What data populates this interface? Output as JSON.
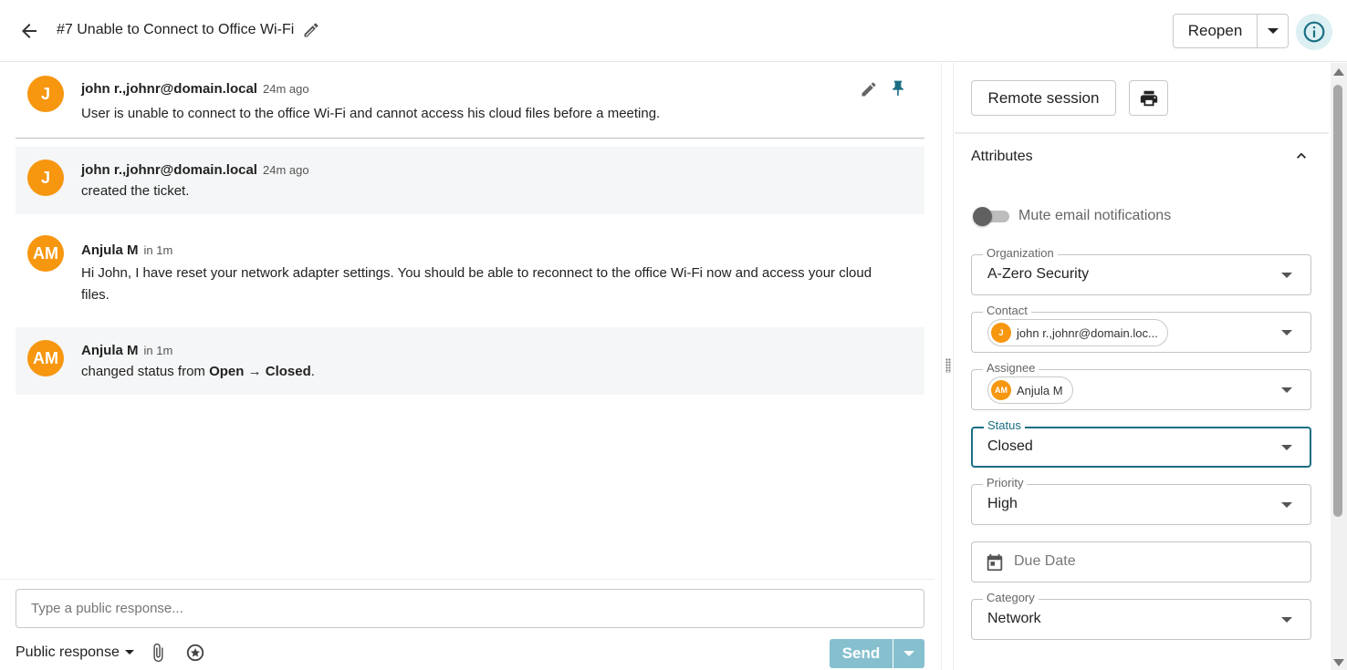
{
  "header": {
    "ticket_title": "#7 Unable to Connect to Office Wi-Fi",
    "reopen_label": "Reopen"
  },
  "messages": [
    {
      "avatar": "J",
      "author": "john r.,johnr@domain.local",
      "time": "24m ago",
      "text": "User is unable to connect to the office Wi-Fi and cannot access his cloud files before a meeting."
    },
    {
      "avatar": "J",
      "author": "john r.,johnr@domain.local",
      "time": "24m ago",
      "text": "created the ticket."
    },
    {
      "avatar": "AM",
      "author": "Anjula M",
      "time": "in 1m",
      "text": "Hi John, I have reset your network adapter settings. You should be able to reconnect to the office Wi-Fi now and access your cloud files."
    },
    {
      "avatar": "AM",
      "author": "Anjula M",
      "time": "in 1m",
      "text_prefix": "changed status from ",
      "status_from": "Open",
      "arrow": " → ",
      "status_to": "Closed",
      "text_suffix": "."
    }
  ],
  "composer": {
    "placeholder": "Type a public response...",
    "response_type": "Public response",
    "send_label": "Send"
  },
  "sidebar": {
    "remote_session_label": "Remote session",
    "attributes_heading": "Attributes",
    "mute_label": "Mute email notifications",
    "fields": {
      "organization": {
        "label": "Organization",
        "value": "A-Zero Security"
      },
      "contact": {
        "label": "Contact",
        "avatar": "J",
        "value": "john r.,johnr@domain.loc..."
      },
      "assignee": {
        "label": "Assignee",
        "avatar": "AM",
        "value": "Anjula M"
      },
      "status": {
        "label": "Status",
        "value": "Closed"
      },
      "priority": {
        "label": "Priority",
        "value": "High"
      },
      "due_date": {
        "placeholder": "Due Date"
      },
      "category": {
        "label": "Category",
        "value": "Network"
      }
    }
  },
  "colors": {
    "accent": "#1a6e83",
    "avatar": "#f7960f",
    "send_disabled": "#86c0cf",
    "info_bg": "#dceff3"
  }
}
